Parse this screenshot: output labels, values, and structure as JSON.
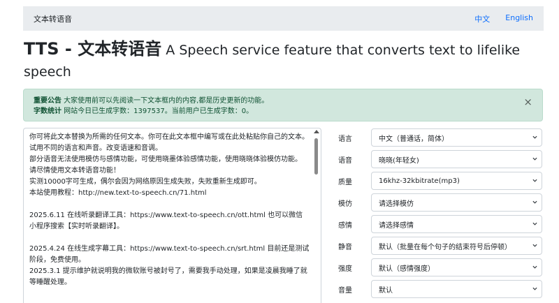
{
  "nav": {
    "brand": "文本转语音",
    "links": [
      "中文",
      "English"
    ]
  },
  "page": {
    "title_strong": "TTS - 文本转语音",
    "title_rest": " A Speech service feature that converts text to lifelike speech"
  },
  "alert": {
    "label1": "重要公告",
    "text1": " 大家使用前可以先阅读一下文本框内的内容,都是历史更新的功能。",
    "label2": "字数统计",
    "text2": " 网站今日已生成字数：1397537。当前用户已生成字数：0。",
    "close": "×"
  },
  "editor": {
    "text": "你可将此文本替换为所需的任何文本。你可在此文本框中编写或在此处粘贴你自己的文本。\n试用不同的语言和声音。改变语速和音调。\n部分语音无法使用模仿与感情功能，可使用晓墨体验感情功能，使用晓晓体验模仿功能。\n请尽情使用文本转语音功能！\n实测10000字可生成，偶尔会因为网络原因生成失败，失败重新生成即可。\n本站使用教程：http://new.text-to-speech.cn/71.html\n\n2025.6.11 在线听录翻译工具：https://www.text-to-speech.cn/ott.html 也可以微信小程序搜索【实时听录翻译】。\n\n2025.4.24 在线生成字幕工具：https://www.text-to-speech.cn/srt.html 目前还是测试阶段，免费使用。\n2025.3.1 提示维护就说明我的微软账号被封号了，需要我手动处理，如果是凌晨我睡了就等睡醒处理。"
  },
  "settings": [
    {
      "label": "语言",
      "value": "中文（普通话，简体）"
    },
    {
      "label": "语音",
      "value": "晓晓(年轻女)"
    },
    {
      "label": "质量",
      "value": "16khz-32kbitrate(mp3)"
    },
    {
      "label": "模仿",
      "value": "请选择模仿"
    },
    {
      "label": "感情",
      "value": "请选择感情"
    },
    {
      "label": "静音",
      "value": "默认（批量在每个句子的结束符号后停顿）"
    },
    {
      "label": "强度",
      "value": "默认（感情强度）"
    },
    {
      "label": "音量",
      "value": "默认"
    }
  ]
}
